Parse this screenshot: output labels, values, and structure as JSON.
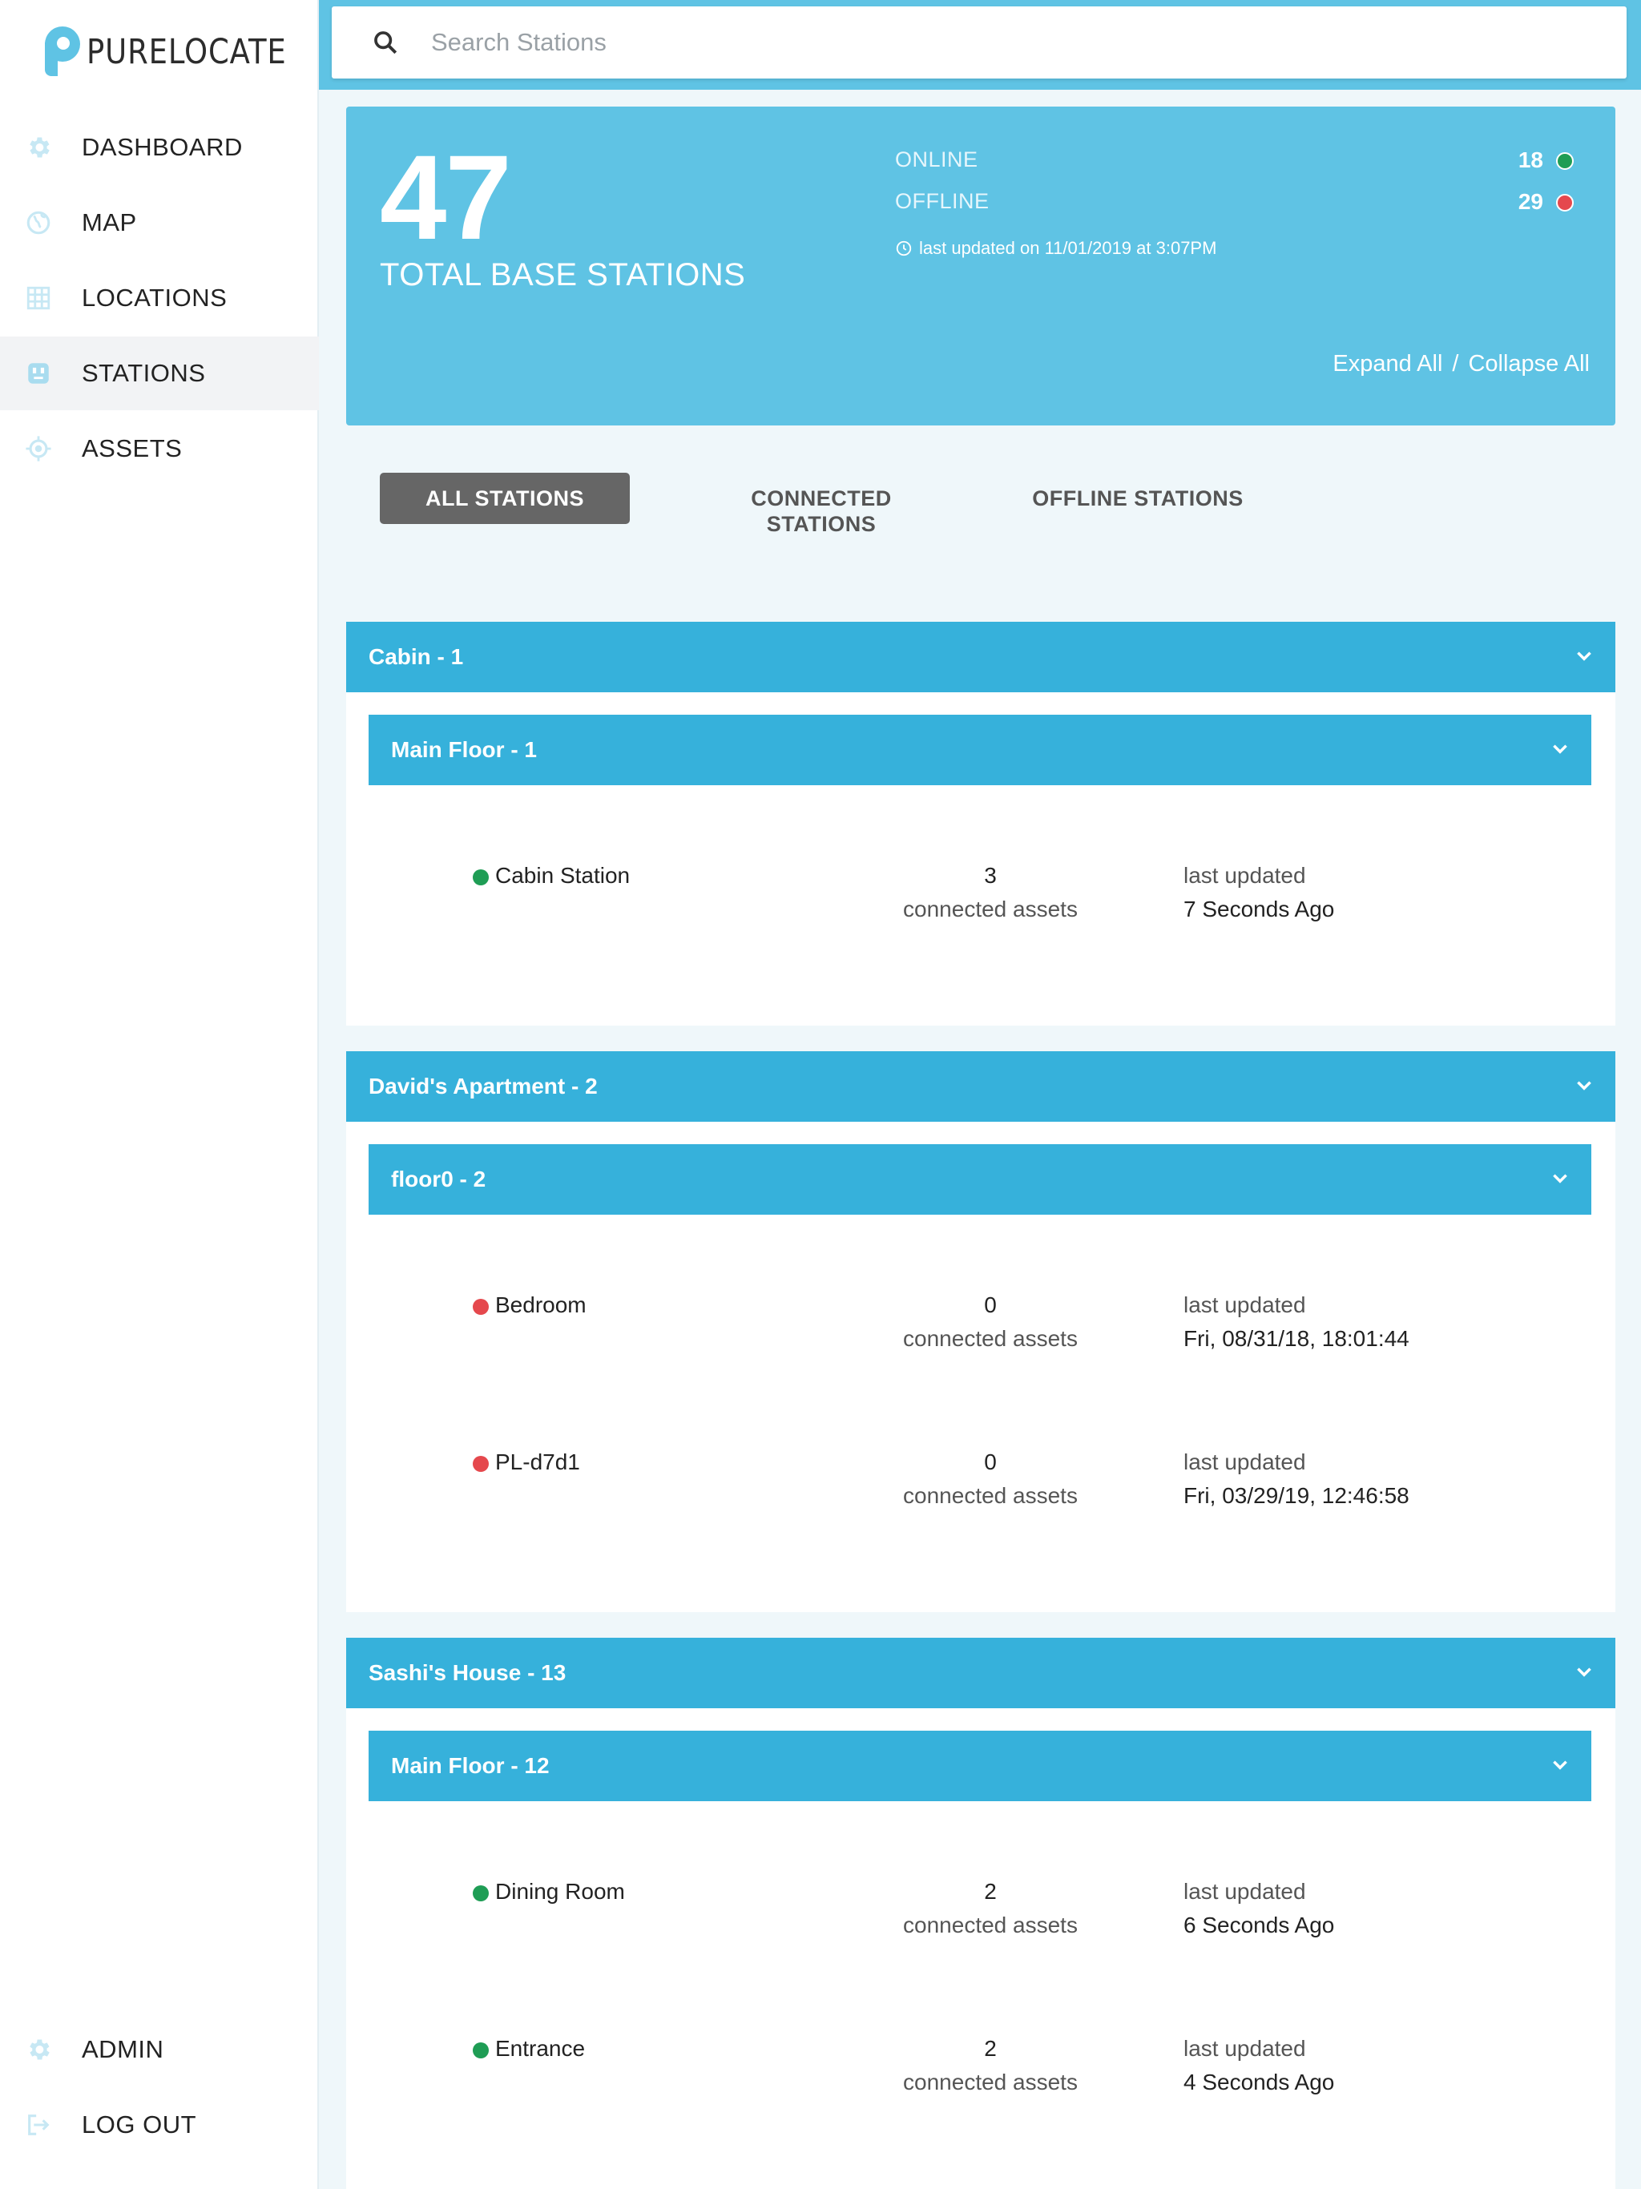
{
  "brand": {
    "name": "PURELOCATE",
    "color": "#5fc3e4"
  },
  "sidebar": {
    "items": [
      {
        "label": "DASHBOARD",
        "icon": "gear-icon"
      },
      {
        "label": "MAP",
        "icon": "globe-icon"
      },
      {
        "label": "LOCATIONS",
        "icon": "grid-icon"
      },
      {
        "label": "STATIONS",
        "icon": "station-icon",
        "active": true
      },
      {
        "label": "ASSETS",
        "icon": "target-icon"
      }
    ],
    "bottom": [
      {
        "label": "ADMIN",
        "icon": "gear-icon"
      },
      {
        "label": "LOG OUT",
        "icon": "logout-icon"
      }
    ]
  },
  "search": {
    "placeholder": "Search Stations",
    "value": ""
  },
  "summary": {
    "total": "47",
    "total_label": "TOTAL BASE STATIONS",
    "online_label": "ONLINE",
    "online_count": "18",
    "offline_label": "OFFLINE",
    "offline_count": "29",
    "last_updated": "last updated on 11/01/2019 at 3:07PM",
    "expand_all": "Expand All",
    "separator": "/",
    "collapse_all": "Collapse All"
  },
  "tabs": [
    {
      "label": "ALL STATIONS",
      "active": true
    },
    {
      "label": "CONNECTED STATIONS"
    },
    {
      "label": "OFFLINE STATIONS"
    }
  ],
  "locations": [
    {
      "title": "Cabin - 1",
      "floors": [
        {
          "title": "Main Floor - 1",
          "stations": [
            {
              "name": "Cabin Station",
              "status": "online",
              "count": "3",
              "count_label": "connected assets",
              "updated_label": "last updated",
              "updated": "7 Seconds Ago"
            }
          ]
        }
      ]
    },
    {
      "title": "David's Apartment - 2",
      "floors": [
        {
          "title": "floor0 - 2",
          "stations": [
            {
              "name": "Bedroom",
              "status": "offline",
              "count": "0",
              "count_label": "connected assets",
              "updated_label": "last updated",
              "updated": "Fri, 08/31/18, 18:01:44"
            },
            {
              "name": "PL-d7d1",
              "status": "offline",
              "count": "0",
              "count_label": "connected assets",
              "updated_label": "last updated",
              "updated": "Fri, 03/29/19, 12:46:58"
            }
          ]
        }
      ]
    },
    {
      "title": "Sashi's House - 13",
      "floors": [
        {
          "title": "Main Floor - 12",
          "stations": [
            {
              "name": "Dining Room",
              "status": "online",
              "count": "2",
              "count_label": "connected assets",
              "updated_label": "last updated",
              "updated": "6 Seconds Ago"
            },
            {
              "name": "Entrance",
              "status": "online",
              "count": "2",
              "count_label": "connected assets",
              "updated_label": "last updated",
              "updated": "4 Seconds Ago"
            }
          ]
        }
      ]
    }
  ],
  "colors": {
    "online": "#1f9d55",
    "offline": "#e5484d",
    "header": "#36b1db",
    "tab_active": "#666666"
  }
}
